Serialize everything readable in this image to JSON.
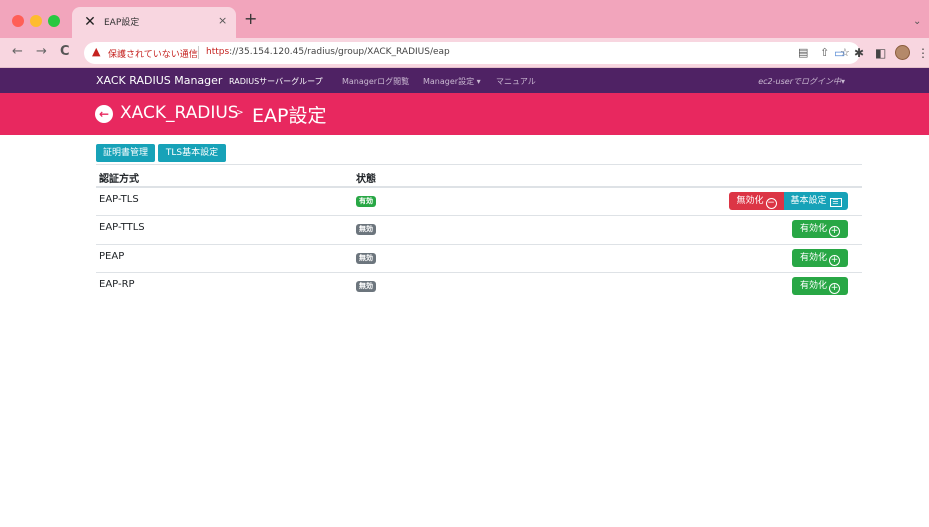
{
  "browser": {
    "tab_title": "EAP設定",
    "tab_close": "×",
    "new_tab": "+",
    "tab_chevron": "⌄",
    "back": "←",
    "forward": "→",
    "reload": "C",
    "security_icon": "▲",
    "security_label": "保護されていない通信",
    "url_scheme": "https",
    "url_rest": "://35.154.120.45/radius/group/XACK_RADIUS/eap",
    "icons": [
      "translate-icon",
      "share-icon",
      "star-icon",
      "extension-icon",
      "puzzle-icon",
      "sidebar-icon",
      "avatar",
      "more-icon"
    ]
  },
  "navbar": {
    "brand": "XACK RADIUS Manager",
    "items": [
      {
        "label": "RADIUSサーバーグループ",
        "active": true
      },
      {
        "label": "Managerログ閲覧",
        "active": false
      },
      {
        "label": "Manager設定 ▾",
        "active": false
      },
      {
        "label": "マニュアル",
        "active": false
      }
    ],
    "user": "ec2-userでログイン中▾"
  },
  "header": {
    "back_icon": "←",
    "group": "XACK_RADIUS",
    "separator": ">",
    "page": "EAP設定"
  },
  "sub_buttons": {
    "cert": "証明書管理",
    "tls": "TLS基本設定"
  },
  "table": {
    "headers": {
      "method": "認証方式",
      "status": "状態"
    },
    "rows": [
      {
        "method": "EAP-TLS",
        "status": "有効",
        "enabled": true
      },
      {
        "method": "EAP-TTLS",
        "status": "無効",
        "enabled": false
      },
      {
        "method": "PEAP",
        "status": "無効",
        "enabled": false
      },
      {
        "method": "EAP-RP",
        "status": "無効",
        "enabled": false
      }
    ]
  },
  "actions": {
    "disable": "無効化",
    "basic_settings": "基本設定",
    "enable": "有効化",
    "minus": "−",
    "plus": "+",
    "list": "☰"
  },
  "colors": {
    "tab_strip": "#f2a5bc",
    "navbar": "#4f2264",
    "header": "#e8285f",
    "success": "#28a745",
    "danger": "#dc3545",
    "info": "#17a2b8",
    "secondary": "#6c757d"
  }
}
